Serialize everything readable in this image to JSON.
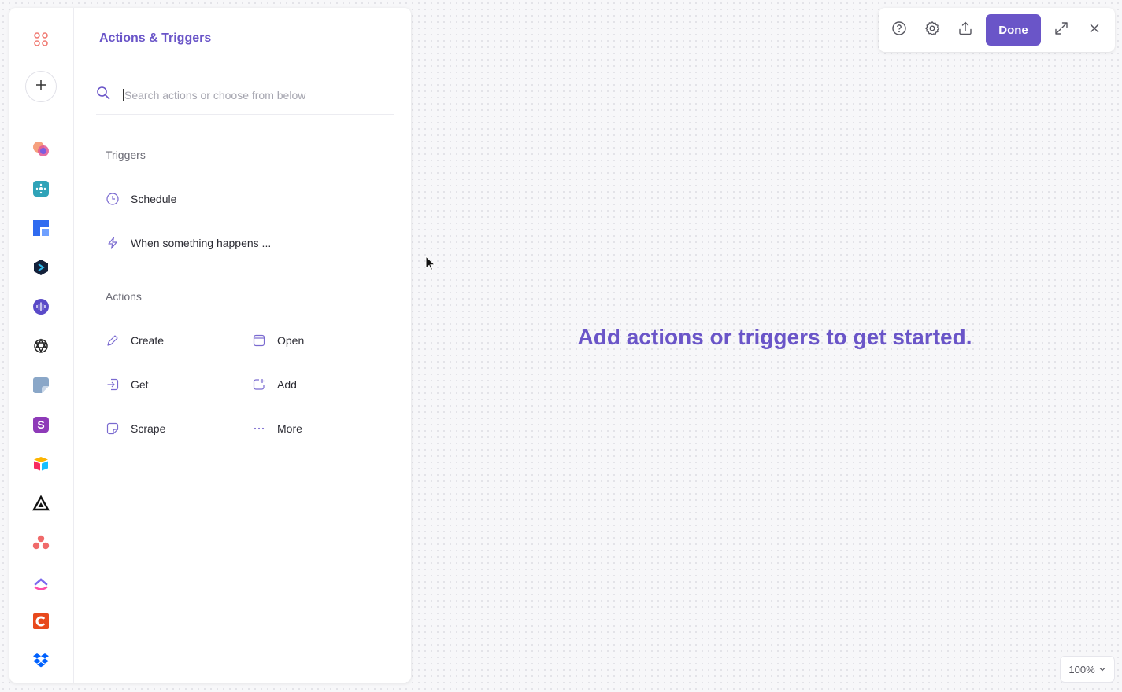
{
  "panel": {
    "title": "Actions & Triggers",
    "search_placeholder": "Search actions or choose from below",
    "triggers_label": "Triggers",
    "triggers": [
      {
        "label": "Schedule",
        "icon": "clock-icon"
      },
      {
        "label": "When something happens ...",
        "icon": "lightning-icon"
      }
    ],
    "actions_label": "Actions",
    "actions": [
      {
        "label": "Create",
        "icon": "pencil-icon"
      },
      {
        "label": "Open",
        "icon": "window-icon"
      },
      {
        "label": "Get",
        "icon": "import-icon"
      },
      {
        "label": "Add",
        "icon": "add-square-icon"
      },
      {
        "label": "Scrape",
        "icon": "sticker-icon"
      },
      {
        "label": "More",
        "icon": "dots-icon"
      }
    ]
  },
  "rail": {
    "apps": [
      "apps-grid-icon",
      "add-icon",
      "multicolor-app-icon",
      "teal-app-icon",
      "blue-board-icon",
      "dark-hexagon-icon",
      "audio-wave-icon",
      "openai-icon",
      "note-icon",
      "s-app-icon",
      "airtable-icon",
      "triangle-app-icon",
      "asana-icon",
      "clickup-icon",
      "orange-c-icon",
      "dropbox-icon"
    ]
  },
  "toolbar": {
    "done_label": "Done",
    "icons": [
      "help-icon",
      "settings-icon",
      "share-icon",
      "expand-icon",
      "close-icon"
    ]
  },
  "canvas": {
    "empty_message": "Add actions or triggers to get started.",
    "zoom_level": "100%"
  },
  "colors": {
    "accent": "#6a55c8",
    "background": "#f7f7f9"
  }
}
